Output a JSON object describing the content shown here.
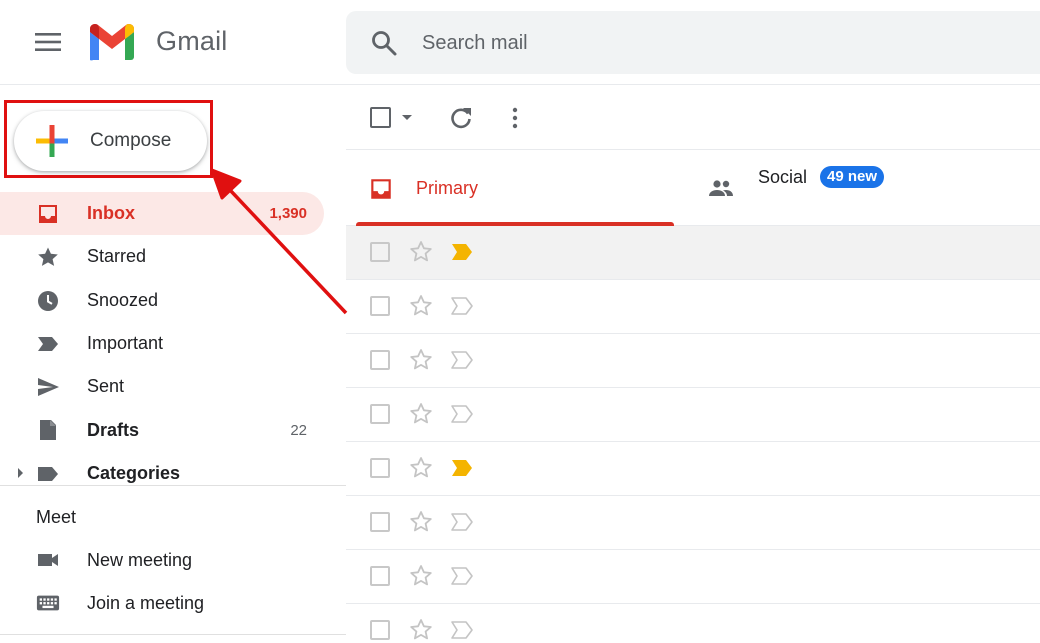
{
  "header": {
    "app_name": "Gmail",
    "search_placeholder": "Search mail"
  },
  "compose": {
    "label": "Compose"
  },
  "nav": {
    "items": [
      {
        "label": "Inbox",
        "count": "1,390",
        "icon": "inbox-icon",
        "active": true
      },
      {
        "label": "Starred",
        "count": "",
        "icon": "star-icon"
      },
      {
        "label": "Snoozed",
        "count": "",
        "icon": "clock-icon"
      },
      {
        "label": "Important",
        "count": "",
        "icon": "important-icon"
      },
      {
        "label": "Sent",
        "count": "",
        "icon": "send-icon"
      },
      {
        "label": "Drafts",
        "count": "22",
        "icon": "draft-icon",
        "bold": true
      },
      {
        "label": "Categories",
        "count": "",
        "icon": "label-icon",
        "bold": true
      }
    ]
  },
  "meet": {
    "title": "Meet",
    "items": [
      {
        "label": "New meeting",
        "icon": "video-camera-icon"
      },
      {
        "label": "Join a meeting",
        "icon": "keyboard-icon"
      }
    ]
  },
  "tabs": {
    "primary": "Primary",
    "social": "Social",
    "social_badge": "49 new"
  },
  "colors": {
    "accent_red": "#d93025",
    "badge_blue": "#1a73e8",
    "annotation_red": "#e01010",
    "important_yellow": "#f4b400"
  },
  "rows": {
    "important_flags": [
      true,
      false,
      false,
      false,
      true,
      false,
      false,
      false
    ]
  }
}
